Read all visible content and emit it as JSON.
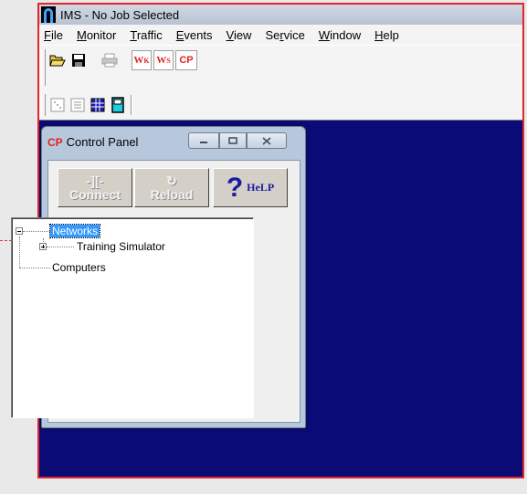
{
  "window": {
    "title": "IMS - No Job Selected"
  },
  "menu": [
    {
      "label": "File",
      "accel": "F",
      "rest": "ile"
    },
    {
      "label": "Monitor",
      "accel": "M",
      "rest": "onitor"
    },
    {
      "label": "Traffic",
      "accel": "T",
      "rest": "raffic"
    },
    {
      "label": "Events",
      "accel": "E",
      "rest": "vents"
    },
    {
      "label": "View",
      "accel": "V",
      "rest": "iew"
    },
    {
      "label": "Service",
      "pre": "Se",
      "accel": "r",
      "rest": "vice"
    },
    {
      "label": "Window",
      "accel": "W",
      "rest": "indow"
    },
    {
      "label": "Help",
      "accel": "H",
      "rest": "elp"
    }
  ],
  "toolbar": {
    "wk_label": {
      "main": "W",
      "sub": "K"
    },
    "ws_label": {
      "main": "W",
      "sub": "S"
    },
    "cp_label": "CP"
  },
  "panel": {
    "logo": "CP",
    "title": "Control Panel",
    "buttons": {
      "connect": "Connect",
      "reload": "Reload",
      "help": "HeLP"
    }
  },
  "tree": {
    "root": "Networks",
    "child": "Training Simulator",
    "sibling": "Computers"
  },
  "colors": {
    "desktop": "#0b0b78",
    "accent_red": "#e0262b",
    "selection": "#3399ff"
  }
}
